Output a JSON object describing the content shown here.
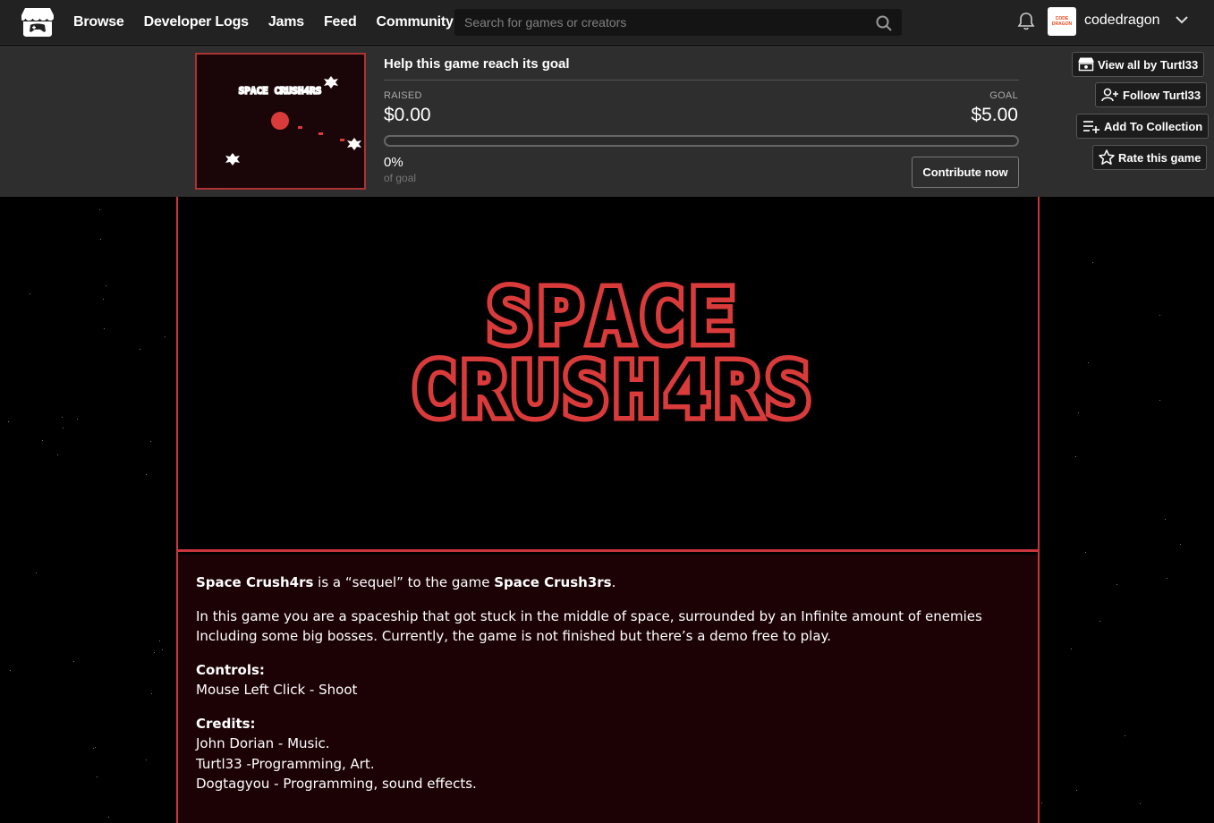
{
  "nav": {
    "links": [
      "Browse",
      "Developer Logs",
      "Jams",
      "Feed",
      "Community"
    ],
    "search_placeholder": "Search for games or creators",
    "username": "codedragon",
    "avatar_text": "CODE DRAGON"
  },
  "fund": {
    "title": "Help this game reach its goal",
    "raised_label": "RAISED",
    "raised_value": "$0.00",
    "goal_label": "GOAL",
    "goal_value": "$5.00",
    "progress_percent": 0,
    "percent_text": "0%",
    "of_goal": "of goal",
    "contribute_label": "Contribute now",
    "thumbnail_title": "SPACE CRUSH4RS"
  },
  "side_actions": {
    "view_all": "View all by Turtl33",
    "follow": "Follow Turtl33",
    "add_collection": "Add To Collection",
    "rate": "Rate this game"
  },
  "banner": {
    "line1": "SPACE",
    "line2": "CRUSH4RS"
  },
  "description": {
    "p1_title": "Space Crush4rs",
    "p1_mid": " is a “sequel” to the game ",
    "p1_link": "Space Crush3rs",
    "p1_end": ".",
    "p2": "In this game you are a spaceship that got stuck in the middle of space, surrounded by an Infinite amount of enemies Including some big bosses. Currently, the game is not finished but there’s a demo free to play.",
    "controls_title": "Controls:",
    "controls_line": "Mouse Left Click - Shoot",
    "credits_title": "Credits:",
    "credits": [
      "John Dorian - Music.",
      "Turtl33 -Programming, Art.",
      "Dogtagyou - Programming, sound effects."
    ]
  },
  "colors": {
    "accent_red": "#c8353a",
    "progress_fill": "#ff6b5b",
    "desc_bg": "#1c0205"
  }
}
